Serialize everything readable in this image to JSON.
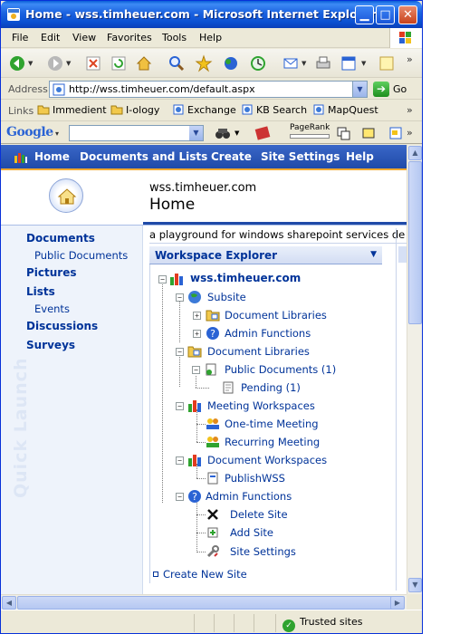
{
  "window": {
    "title": "Home - wss.timheuer.com - Microsoft Internet Explorer",
    "minimize_icon": "minimize-icon",
    "maximize_icon": "maximize-icon",
    "close_icon": "close-icon"
  },
  "menubar": {
    "items": [
      "File",
      "Edit",
      "View",
      "Favorites",
      "Tools",
      "Help"
    ]
  },
  "toolbar": {
    "buttons": [
      "back-icon",
      "forward-icon",
      "stop-icon",
      "refresh-icon",
      "home-icon",
      "search-icon",
      "favorites-icon",
      "media-icon",
      "history-icon",
      "mail-icon",
      "print-icon",
      "edit-icon",
      "messenger-icon"
    ]
  },
  "address": {
    "label": "Address",
    "url": "http://wss.timheuer.com/default.aspx",
    "go_label": "Go"
  },
  "links": {
    "label": "Links",
    "items": [
      "Immedient",
      "I-ology",
      "Exchange",
      "KB Search",
      "MapQuest"
    ]
  },
  "google": {
    "logo": "Google",
    "pagerank_label": "PageRank"
  },
  "sharepoint": {
    "topnav": [
      "Home",
      "Documents and Lists",
      "Create",
      "Site Settings",
      "Help"
    ],
    "site_name": "wss.timheuer.com",
    "page_title": "Home",
    "description": "a playground for windows sharepoint services de",
    "quick_launch": {
      "watermark": "Quick Launch",
      "documents": "Documents",
      "public_documents": "Public Documents",
      "pictures": "Pictures",
      "lists": "Lists",
      "events": "Events",
      "discussions": "Discussions",
      "surveys": "Surveys"
    },
    "workspace_explorer": {
      "title": "Workspace Explorer",
      "root": "wss.timheuer.com",
      "subsite": "Subsite",
      "subsite_doclibs": "Document Libraries",
      "subsite_admin": "Admin Functions",
      "doclibs": "Document Libraries",
      "public_docs": "Public Documents (1)",
      "pending": "Pending (1)",
      "meeting_ws": "Meeting Workspaces",
      "one_time": "One-time Meeting",
      "recurring": "Recurring Meeting",
      "document_ws": "Document Workspaces",
      "publishwss": "PublishWSS",
      "admin": "Admin Functions",
      "delete_site": "Delete Site",
      "add_site": "Add Site",
      "site_settings": "Site Settings",
      "create_new_site": "Create New Site"
    }
  },
  "status": {
    "zone": "Trusted sites"
  },
  "colors": {
    "title_bar": "#0a4fd0",
    "sp_nav": "#1f4aa8",
    "link": "#003399",
    "accent_rule": "#f0a830"
  }
}
